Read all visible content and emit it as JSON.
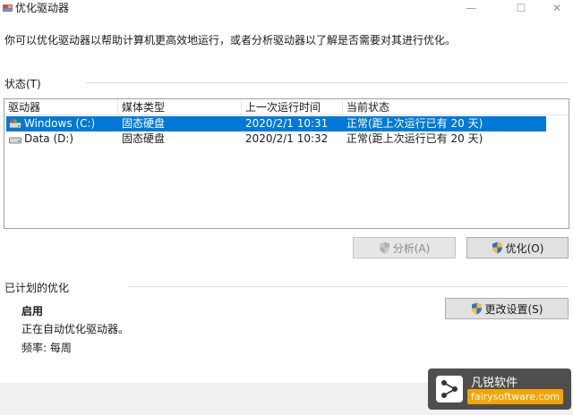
{
  "window": {
    "title": "优化驱动器",
    "minimize": "—",
    "maximize": "☐",
    "close": "✕"
  },
  "description": "你可以优化驱动器以帮助计算机更高效地运行，或者分析驱动器以了解是否需要对其进行优化。",
  "status_section": {
    "label": "状态(T)"
  },
  "table": {
    "columns": [
      "驱动器",
      "媒体类型",
      "上一次运行时间",
      "当前状态"
    ],
    "rows": [
      {
        "drive": "Windows (C:)",
        "media": "固态硬盘",
        "last_run": "2020/2/1 10:31",
        "status": "正常(距上次运行已有 20 天)",
        "selected": true
      },
      {
        "drive": "Data (D:)",
        "media": "固态硬盘",
        "last_run": "2020/2/1 10:32",
        "status": "正常(距上次运行已有 20 天)",
        "selected": false
      }
    ]
  },
  "buttons": {
    "analyze": "分析(A)",
    "optimize": "优化(O)",
    "change_settings": "更改设置(S)"
  },
  "schedule": {
    "label": "已计划的优化",
    "state": "启用",
    "description": "正在自动优化驱动器。",
    "frequency": "频率: 每周"
  },
  "watermark": {
    "name": "凡锐软件",
    "url": "fairysoftware.com"
  },
  "colors": {
    "selection": "#0078d7",
    "watermark_accent": "#f5a400"
  },
  "icons": {
    "app": "defrag-app-icon",
    "drive": "drive-icon",
    "shield": "uac-shield-icon"
  }
}
